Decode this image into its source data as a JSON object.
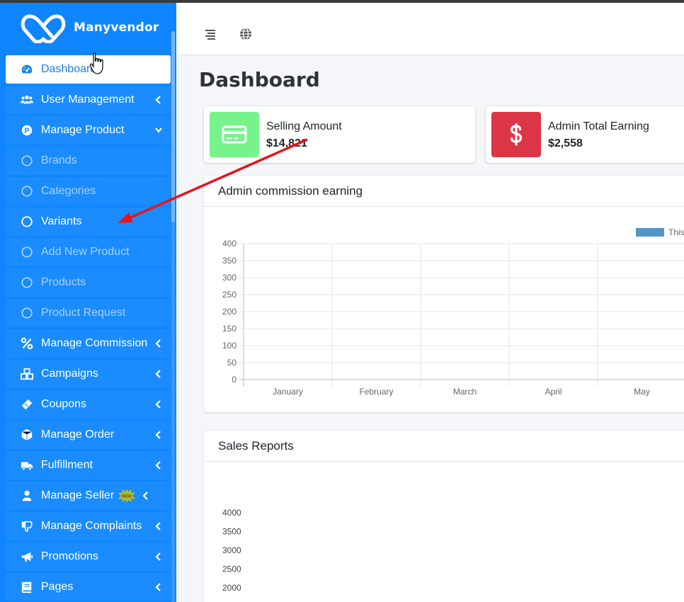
{
  "brand": {
    "name": "Manyvendor"
  },
  "sidebar": {
    "items": [
      {
        "label": "Dashboard",
        "icon": "tachometer-icon",
        "name": "sidebar-item-dashboard"
      },
      {
        "label": "User Management",
        "icon": "users-icon",
        "name": "sidebar-item-user-management"
      },
      {
        "label": "Manage Product",
        "icon": "product-p-icon",
        "name": "sidebar-item-manage-product"
      },
      {
        "label": "Brands",
        "icon": "circle-icon",
        "name": "sidebar-item-brands"
      },
      {
        "label": "Categories",
        "icon": "circle-icon",
        "name": "sidebar-item-categories"
      },
      {
        "label": "Variants",
        "icon": "circle-icon",
        "name": "sidebar-item-variants"
      },
      {
        "label": "Add New Product",
        "icon": "circle-icon",
        "name": "sidebar-item-add-new-product"
      },
      {
        "label": "Products",
        "icon": "circle-icon",
        "name": "sidebar-item-products"
      },
      {
        "label": "Product Request",
        "icon": "circle-icon",
        "name": "sidebar-item-product-request"
      },
      {
        "label": "Manage Commission",
        "icon": "percent-icon",
        "name": "sidebar-item-manage-commission"
      },
      {
        "label": "Campaigns",
        "icon": "cubes-icon",
        "name": "sidebar-item-campaigns"
      },
      {
        "label": "Coupons",
        "icon": "ticket-icon",
        "name": "sidebar-item-coupons"
      },
      {
        "label": "Manage Order",
        "icon": "box-icon",
        "name": "sidebar-item-manage-order"
      },
      {
        "label": "Fulfillment",
        "icon": "truck-icon",
        "name": "sidebar-item-fulfillment"
      },
      {
        "label": "Manage Seller",
        "icon": "user-icon",
        "name": "sidebar-item-manage-seller"
      },
      {
        "label": "Manage Complaints",
        "icon": "thumbs-down-icon",
        "name": "sidebar-item-manage-complaints"
      },
      {
        "label": "Promotions",
        "icon": "bullhorn-icon",
        "name": "sidebar-item-promotions"
      },
      {
        "label": "Pages",
        "icon": "book-icon",
        "name": "sidebar-item-pages"
      }
    ],
    "new_badge": "NEW"
  },
  "main": {
    "page_title": "Dashboard",
    "info_boxes": [
      {
        "label": "Selling Amount",
        "value": "$14,821",
        "icon": "credit-card-icon",
        "color": "#77f38c"
      },
      {
        "label": "Admin Total Earning",
        "value": "$2,558",
        "icon": "dollar-icon",
        "color": "#dc3545"
      }
    ],
    "commission_card": {
      "title": "Admin commission earning"
    },
    "sales_card": {
      "title": "Sales Reports"
    }
  },
  "chart_data": [
    {
      "type": "bar",
      "title": "Admin commission earning",
      "categories": [
        "January",
        "February",
        "March",
        "April",
        "May"
      ],
      "series": [
        {
          "name": "This",
          "values": [
            0,
            0,
            0,
            0,
            0
          ],
          "color": "#5196c4"
        }
      ],
      "ylim": [
        0,
        400
      ],
      "yticks": [
        0,
        50,
        100,
        150,
        200,
        250,
        300,
        350,
        400
      ],
      "grid": true,
      "legend": "top-right"
    },
    {
      "type": "line",
      "title": "Sales Reports",
      "yticks_visible": [
        2000,
        2500,
        3000,
        3500,
        4000
      ]
    }
  ],
  "colors": {
    "sidebar": "#0f86ff",
    "active_text": "#1a7fe8",
    "annotation_arrow": "#e8141b"
  }
}
